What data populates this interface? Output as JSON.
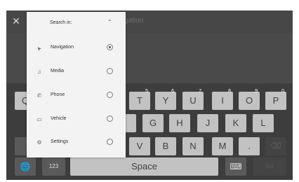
{
  "header": {
    "title_fragment": "gation",
    "close_glyph": "✕"
  },
  "search_menu": {
    "title": "Search in:",
    "chevron_glyph": "⌃",
    "options": [
      {
        "label": "Navigation",
        "icon": "navigation-arrow-icon",
        "glyph": "➤",
        "selected": true
      },
      {
        "label": "Media",
        "icon": "music-note-icon",
        "glyph": "♫",
        "selected": false
      },
      {
        "label": "Phone",
        "icon": "phone-icon",
        "glyph": "✆",
        "selected": false
      },
      {
        "label": "Vehicle",
        "icon": "vehicle-icon",
        "glyph": "▭",
        "selected": false
      },
      {
        "label": "Settings",
        "icon": "gear-icon",
        "glyph": "⚙",
        "selected": false
      }
    ]
  },
  "keyboard": {
    "row1": [
      {
        "label": "Q",
        "hint": ""
      },
      {
        "label": "T",
        "hint": "5"
      },
      {
        "label": "Y",
        "hint": "6"
      },
      {
        "label": "U",
        "hint": "7"
      },
      {
        "label": "I",
        "hint": "8"
      },
      {
        "label": "O",
        "hint": "9"
      },
      {
        "label": "P",
        "hint": "0"
      }
    ],
    "row2": [
      "G",
      "H",
      "J",
      "K",
      "L"
    ],
    "row3": [
      "V",
      "B",
      "N",
      "M",
      "."
    ],
    "space_label": "Space",
    "numbers_label": "123",
    "go_label": "Go",
    "globe_glyph": "🌐",
    "keyboard_glyph": "⌨",
    "backspace_glyph": "⌫"
  }
}
